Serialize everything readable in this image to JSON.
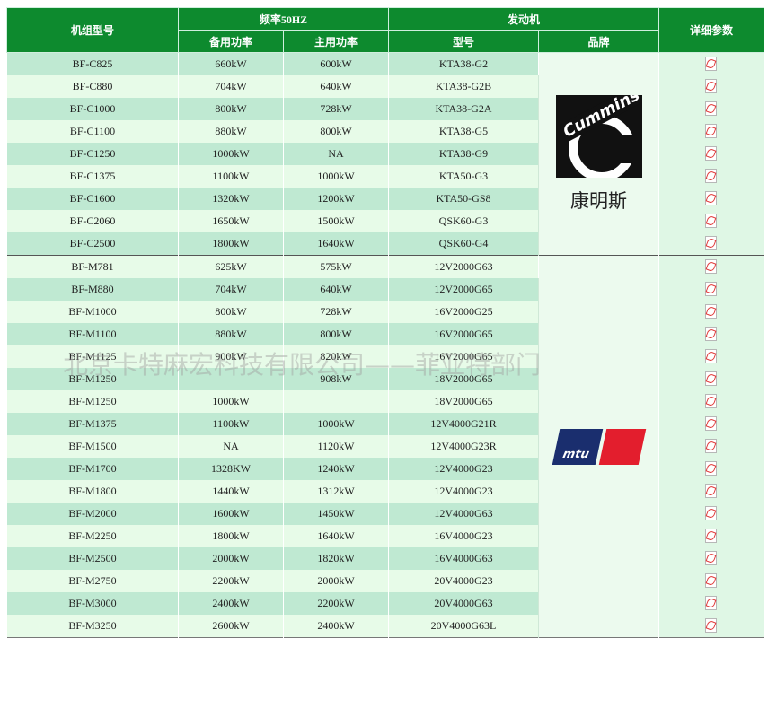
{
  "header": {
    "model": "机组型号",
    "freq": "频率50HZ",
    "standby": "备用功率",
    "prime": "主用功率",
    "engine": "发动机",
    "engine_model": "型号",
    "brand": "品牌",
    "details": "详细参数"
  },
  "brands": {
    "cummins": {
      "logo_text": "Cummins",
      "cn": "康明斯"
    },
    "mtu": {
      "logo_text": "mtu"
    }
  },
  "watermark": "北京卡特麻宏科技有限公司——菲亚特部门",
  "rows": [
    {
      "model": "BF-C825",
      "standby": "660kW",
      "prime": "600kW",
      "engine": "KTA38-G2"
    },
    {
      "model": "BF-C880",
      "standby": "704kW",
      "prime": "640kW",
      "engine": "KTA38-G2B"
    },
    {
      "model": "BF-C1000",
      "standby": "800kW",
      "prime": "728kW",
      "engine": "KTA38-G2A"
    },
    {
      "model": "BF-C1100",
      "standby": "880kW",
      "prime": "800kW",
      "engine": "KTA38-G5"
    },
    {
      "model": "BF-C1250",
      "standby": "1000kW",
      "prime": "NA",
      "engine": "KTA38-G9"
    },
    {
      "model": "BF-C1375",
      "standby": "1100kW",
      "prime": "1000kW",
      "engine": "KTA50-G3"
    },
    {
      "model": "BF-C1600",
      "standby": "1320kW",
      "prime": "1200kW",
      "engine": "KTA50-GS8"
    },
    {
      "model": "BF-C2060",
      "standby": "1650kW",
      "prime": "1500kW",
      "engine": "QSK60-G3"
    },
    {
      "model": "BF-C2500",
      "standby": "1800kW",
      "prime": "1640kW",
      "engine": "QSK60-G4"
    },
    {
      "model": "BF-M781",
      "standby": "625kW",
      "prime": "575kW",
      "engine": "12V2000G63"
    },
    {
      "model": "BF-M880",
      "standby": "704kW",
      "prime": "640kW",
      "engine": "12V2000G65"
    },
    {
      "model": "BF-M1000",
      "standby": "800kW",
      "prime": "728kW",
      "engine": "16V2000G25"
    },
    {
      "model": "BF-M1100",
      "standby": "880kW",
      "prime": "800kW",
      "engine": "16V2000G65"
    },
    {
      "model": "BF-M1125",
      "standby": "900kW",
      "prime": "820kW",
      "engine": "16V2000G65"
    },
    {
      "model": "BF-M1250",
      "standby": "",
      "prime": "908kW",
      "engine": "18V2000G65"
    },
    {
      "model": "BF-M1250",
      "standby": "1000kW",
      "prime": "",
      "engine": "18V2000G65"
    },
    {
      "model": "BF-M1375",
      "standby": "1100kW",
      "prime": "1000kW",
      "engine": "12V4000G21R"
    },
    {
      "model": "BF-M1500",
      "standby": "NA",
      "prime": "1120kW",
      "engine": "12V4000G23R"
    },
    {
      "model": "BF-M1700",
      "standby": "1328KW",
      "prime": "1240kW",
      "engine": "12V4000G23"
    },
    {
      "model": "BF-M1800",
      "standby": "1440kW",
      "prime": "1312kW",
      "engine": "12V4000G23"
    },
    {
      "model": "BF-M2000",
      "standby": "1600kW",
      "prime": "1450kW",
      "engine": "12V4000G63"
    },
    {
      "model": "BF-M2250",
      "standby": "1800kW",
      "prime": "1640kW",
      "engine": "16V4000G23"
    },
    {
      "model": "BF-M2500",
      "standby": "2000kW",
      "prime": "1820kW",
      "engine": "16V4000G63"
    },
    {
      "model": "BF-M2750",
      "standby": "2200kW",
      "prime": "2000kW",
      "engine": "20V4000G23"
    },
    {
      "model": "BF-M3000",
      "standby": "2400kW",
      "prime": "2200kW",
      "engine": "20V4000G63"
    },
    {
      "model": "BF-M3250",
      "standby": "2600kW",
      "prime": "2400kW",
      "engine": "20V4000G63L"
    }
  ]
}
